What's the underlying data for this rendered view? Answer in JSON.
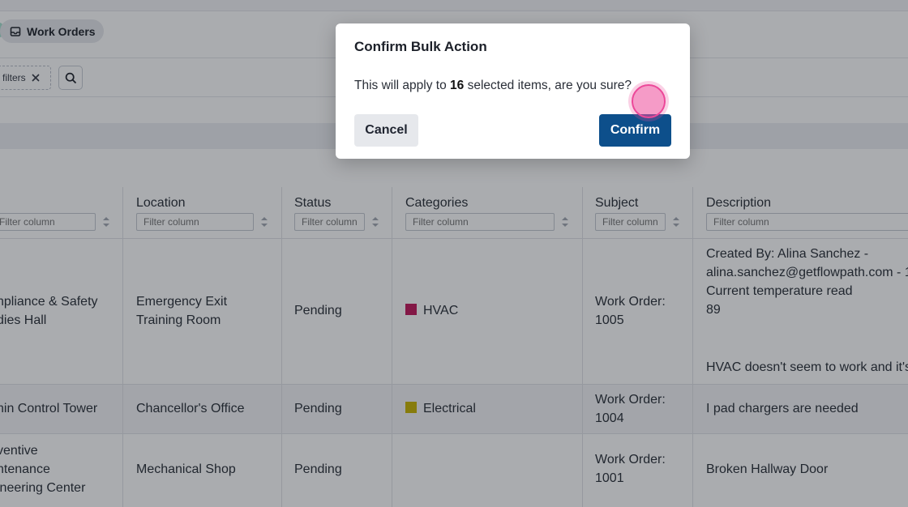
{
  "breadcrumb": {
    "label": "Work Orders",
    "icon": "inbox-icon"
  },
  "filters": {
    "chip_label": "filters",
    "clear_icon": "close-icon",
    "search_icon": "search-icon"
  },
  "table": {
    "columns": [
      {
        "key": "name",
        "label": "",
        "filter_placeholder": "Filter column"
      },
      {
        "key": "location",
        "label": "Location",
        "filter_placeholder": "Filter column"
      },
      {
        "key": "status",
        "label": "Status",
        "filter_placeholder": "Filter column"
      },
      {
        "key": "categories",
        "label": "Categories",
        "filter_placeholder": "Filter column"
      },
      {
        "key": "subject",
        "label": "Subject",
        "filter_placeholder": "Filter column"
      },
      {
        "key": "description",
        "label": "Description",
        "filter_placeholder": "Filter column"
      }
    ],
    "rows": [
      {
        "name": [
          "npliance & Safety",
          "dies Hall"
        ],
        "location": [
          "Emergency Exit",
          "Training Room"
        ],
        "status": "Pending",
        "category": "HVAC",
        "category_color": "#c2185b",
        "subject": [
          "Work Order:",
          "1005"
        ],
        "description": [
          "Created By: Alina Sanchez -",
          "alina.sanchez@getflowpath.com - 1",
          "Current temperature read",
          "89",
          "HVAC doesn't seem to work and it's"
        ]
      },
      {
        "name": [
          "nin Control Tower"
        ],
        "location": [
          "Chancellor's Office"
        ],
        "status": "Pending",
        "category": "Electrical",
        "category_color": "#c8b400",
        "subject": [
          "Work Order:",
          "1004"
        ],
        "description": [
          "I pad chargers are needed"
        ]
      },
      {
        "name": [
          "ventive",
          "ntenance",
          "ineering Center"
        ],
        "location": [
          "Mechanical Shop"
        ],
        "status": "Pending",
        "category": "",
        "category_color": "",
        "subject": [
          "Work Order:",
          "1001"
        ],
        "description": [
          "Broken Hallway Door"
        ]
      }
    ]
  },
  "modal": {
    "title": "Confirm Bulk Action",
    "body_prefix": "This will apply to ",
    "count": "16",
    "body_suffix": " selected items, are you sure?",
    "cancel_label": "Cancel",
    "confirm_label": "Confirm",
    "confirm_color": "#0d4f8b"
  }
}
